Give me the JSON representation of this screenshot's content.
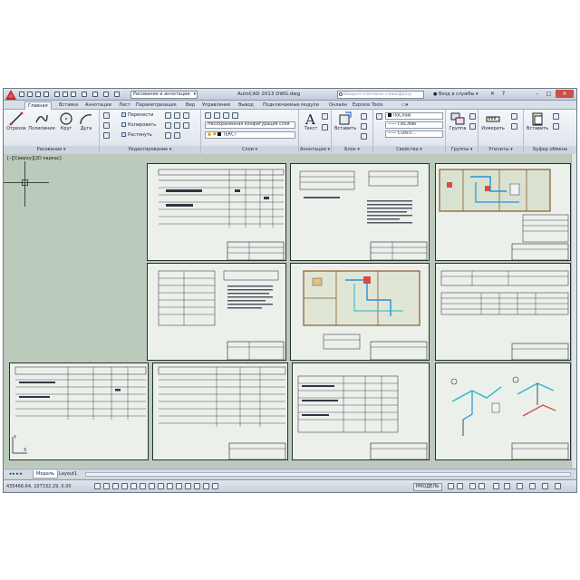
{
  "app": {
    "window_title": "AutoCAD 2013    DWG.dwg",
    "workspace": "Рисование и аннотации",
    "search_placeholder": "Введите ключевое слово/фразу",
    "signin_label": "Вход в службы",
    "logo_color": "#c8262c"
  },
  "ribbon": {
    "tabs": [
      "Главная",
      "Вставка",
      "Аннотации",
      "Лист",
      "Параметризация",
      "Вид",
      "Управление",
      "Вывод",
      "Подключаемые модули",
      "Онлайн",
      "Express Tools"
    ],
    "active_tab": "Главная",
    "draw": {
      "title": "Рисование",
      "line": "Отрезок",
      "polyline": "Полилиния",
      "circle": "Круг",
      "arc": "Дуга"
    },
    "modify": {
      "title": "Редактирование",
      "move": "Перенести",
      "copy": "Копировать",
      "stretch": "Растянуть"
    },
    "layers": {
      "title": "Слои",
      "layer_state": "Несохраненная конфигурация слоя",
      "current_layer": "ТЕКСТ"
    },
    "annotation": {
      "title": "Аннотации",
      "text": "Текст"
    },
    "block": {
      "title": "Блок",
      "insert": "Вставить"
    },
    "properties": {
      "title": "Свойства",
      "color": "ПоСлою",
      "linetype": "ПоСлою",
      "lineweight": "CONTI..."
    },
    "groups": {
      "title": "Группы",
      "group": "Группа"
    },
    "utilities": {
      "title": "Утилиты",
      "measure": "Измерить"
    },
    "clipboard": {
      "title": "Буфер обмена",
      "paste": "Вставить"
    }
  },
  "canvas": {
    "view_label": "[–][Сверху][2D каркас]",
    "background": "#bccabb"
  },
  "layout_tabs": [
    "Модель",
    "Layout1"
  ],
  "status": {
    "coordinates": "435466.64, 107332.29, 0.00",
    "model_label": "РМОДЕЛЬ"
  }
}
